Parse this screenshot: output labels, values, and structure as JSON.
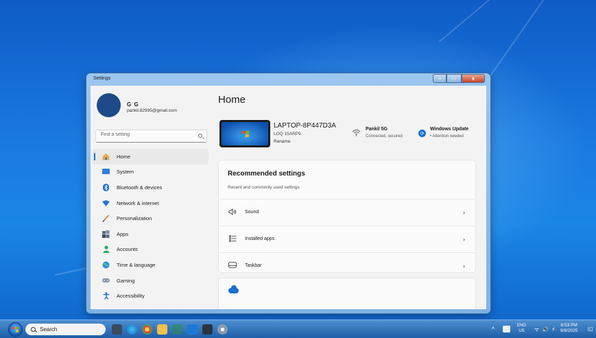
{
  "window": {
    "title": "Settings",
    "controls": [
      "–",
      "□",
      "x"
    ]
  },
  "user": {
    "name": "G G",
    "email": "pankil.82995@gmail.com"
  },
  "search": {
    "placeholder": "Find a setting"
  },
  "sidebar": {
    "items": [
      {
        "label": "Home",
        "icon": "home-icon",
        "active": true
      },
      {
        "label": "System",
        "icon": "system-icon"
      },
      {
        "label": "Bluetooth & devices",
        "icon": "bluetooth-icon"
      },
      {
        "label": "Network & internet",
        "icon": "wifi-diamond-icon"
      },
      {
        "label": "Personalization",
        "icon": "brush-icon"
      },
      {
        "label": "Apps",
        "icon": "apps-icon"
      },
      {
        "label": "Accounts",
        "icon": "person-icon"
      },
      {
        "label": "Time & language",
        "icon": "globe-clock-icon"
      },
      {
        "label": "Gaming",
        "icon": "gamepad-icon"
      },
      {
        "label": "Accessibility",
        "icon": "accessibility-icon"
      }
    ]
  },
  "main": {
    "title": "Home",
    "device": {
      "name": "LAPTOP-8P447D3A",
      "model": "LOQ 15ARP9",
      "rename": "Rename"
    },
    "network": {
      "name": "Pankil 5G",
      "status": "Connected, secured"
    },
    "update": {
      "title": "Windows Update",
      "status": "• Attention needed"
    },
    "recommended": {
      "title": "Recommended settings",
      "subtitle": "Recent and commonly used settings",
      "rows": [
        {
          "label": "Sound",
          "icon": "speaker-icon"
        },
        {
          "label": "Installed apps",
          "icon": "list-icon"
        },
        {
          "label": "Taskbar",
          "icon": "taskbar-icon"
        }
      ]
    }
  },
  "taskbar": {
    "search_label": "Search",
    "lang_top": "ENG",
    "lang_bottom": "US",
    "time": "8:53 PM",
    "date": "9/8/2025"
  },
  "colors": {
    "accent": "#1a6fd0",
    "desktop": "#1b7ae0"
  }
}
